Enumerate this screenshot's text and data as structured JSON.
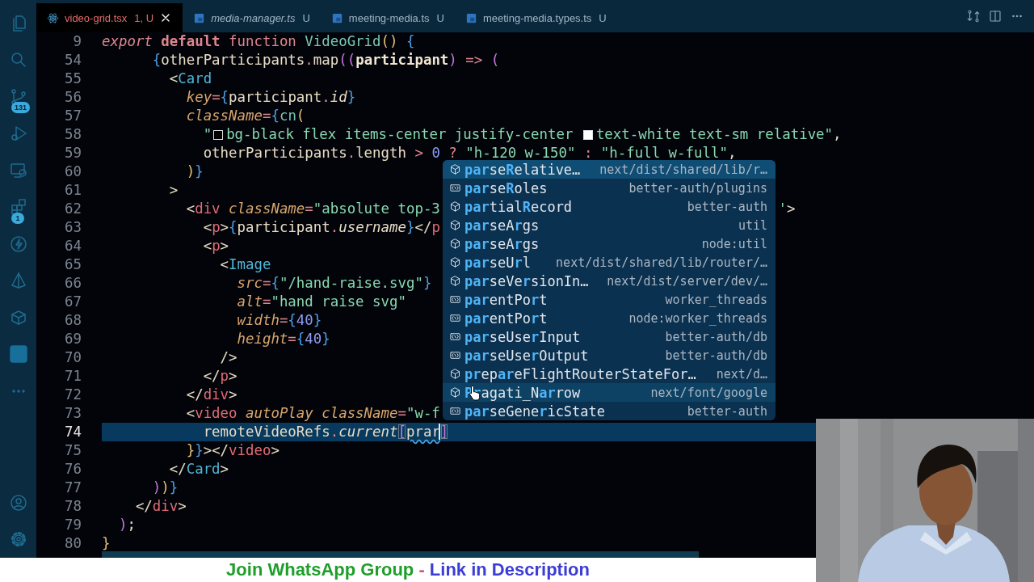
{
  "activity_bar": {
    "items": [
      {
        "kind": "files"
      },
      {
        "kind": "search"
      },
      {
        "kind": "source-control",
        "badge": "131"
      },
      {
        "kind": "debug"
      },
      {
        "kind": "remote"
      },
      {
        "kind": "extensions",
        "badge": "1"
      },
      {
        "kind": "bolt"
      },
      {
        "kind": "prism"
      },
      {
        "kind": "box"
      },
      {
        "kind": "square"
      },
      {
        "kind": "more"
      }
    ],
    "bottom_items": [
      {
        "kind": "account"
      },
      {
        "kind": "settings"
      }
    ]
  },
  "tabs": [
    {
      "kind": "tsx",
      "name": "video-grid.tsx",
      "status": "1, U",
      "selected": true,
      "preview": false,
      "has_errors": true
    },
    {
      "kind": "ts",
      "name": "media-manager.ts",
      "status": "U",
      "selected": false,
      "preview": true,
      "has_errors": false
    },
    {
      "kind": "ts",
      "name": "meeting-media.ts",
      "status": "U",
      "selected": false,
      "preview": false,
      "has_errors": false
    },
    {
      "kind": "ts",
      "name": "meeting-media.types.ts",
      "status": "U",
      "selected": false,
      "preview": false,
      "has_errors": false
    }
  ],
  "editor": {
    "lines": [
      {
        "number": "9",
        "current": false,
        "tokens": [
          {
            "kind": "modifier",
            "t": "export "
          },
          {
            "kind": "storage",
            "t": "default "
          },
          {
            "kind": "keyword",
            "t": "function "
          },
          {
            "kind": "function",
            "t": "VideoGrid"
          },
          {
            "kind": "paren",
            "t": "() "
          },
          {
            "kind": "brace",
            "t": "{"
          }
        ]
      },
      {
        "number": "54",
        "current": false,
        "tokens": [
          {
            "kind": "brace",
            "t": "      {"
          },
          {
            "kind": "plain",
            "t": "otherParticipants"
          },
          {
            "kind": "operator",
            "t": "."
          },
          {
            "kind": "plain",
            "t": "map"
          },
          {
            "kind": "bracket",
            "t": "(("
          },
          {
            "kind": "parameter",
            "t": "participant"
          },
          {
            "kind": "bracket",
            "t": ") "
          },
          {
            "kind": "operator",
            "t": "=> "
          },
          {
            "kind": "bracket",
            "t": "("
          }
        ]
      },
      {
        "number": "55",
        "current": false,
        "tokens": [
          {
            "kind": "punctuation",
            "t": "        <"
          },
          {
            "kind": "component",
            "t": "Card"
          }
        ]
      },
      {
        "number": "56",
        "current": false,
        "tokens": [
          {
            "kind": "attribute",
            "t": "          key"
          },
          {
            "kind": "operator",
            "t": "="
          },
          {
            "kind": "brace",
            "t": "{"
          },
          {
            "kind": "plain",
            "t": "participant"
          },
          {
            "kind": "operator",
            "t": "."
          },
          {
            "kind": "property",
            "t": "id"
          },
          {
            "kind": "brace",
            "t": "}"
          }
        ]
      },
      {
        "number": "57",
        "current": false,
        "tokens": [
          {
            "kind": "attribute",
            "t": "          className"
          },
          {
            "kind": "operator",
            "t": "="
          },
          {
            "kind": "brace",
            "t": "{"
          },
          {
            "kind": "function",
            "t": "cn"
          },
          {
            "kind": "paren",
            "t": "("
          }
        ]
      },
      {
        "number": "58",
        "current": false,
        "tokens": [
          {
            "kind": "string",
            "t": "            \""
          },
          {
            "kind": "swatch",
            "color": "#000000"
          },
          {
            "kind": "string",
            "t": "bg-black flex items-center justify-center "
          },
          {
            "kind": "swatch",
            "color": "#ffffff"
          },
          {
            "kind": "string",
            "t": "text-white text-sm relative\""
          },
          {
            "kind": "punctuation",
            "t": ","
          }
        ]
      },
      {
        "number": "59",
        "current": false,
        "tokens": [
          {
            "kind": "plain",
            "t": "            otherParticipants"
          },
          {
            "kind": "operator",
            "t": "."
          },
          {
            "kind": "plain",
            "t": "length "
          },
          {
            "kind": "operator",
            "t": "> "
          },
          {
            "kind": "number",
            "t": "0 "
          },
          {
            "kind": "operator",
            "t": "? "
          },
          {
            "kind": "string",
            "t": "\"h-120 w-150\" "
          },
          {
            "kind": "operator",
            "t": ": "
          },
          {
            "kind": "string",
            "t": "\"h-full w-full\""
          },
          {
            "kind": "punctuation",
            "t": ","
          }
        ]
      },
      {
        "number": "60",
        "current": false,
        "tokens": [
          {
            "kind": "paren",
            "t": "          )"
          },
          {
            "kind": "brace",
            "t": "}"
          }
        ]
      },
      {
        "number": "61",
        "current": false,
        "tokens": [
          {
            "kind": "punctuation",
            "t": "        >"
          }
        ]
      },
      {
        "number": "62",
        "current": false,
        "tokens": [
          {
            "kind": "punctuation",
            "t": "          <"
          },
          {
            "kind": "tag",
            "t": "div "
          },
          {
            "kind": "attribute",
            "t": "className"
          },
          {
            "kind": "operator",
            "t": "="
          },
          {
            "kind": "string",
            "t": "\"absolute top-3"
          }
        ],
        "tail": [
          {
            "kind": "string",
            "t": "'"
          },
          {
            "kind": "punctuation",
            "t": ">"
          }
        ]
      },
      {
        "number": "63",
        "current": false,
        "tokens": [
          {
            "kind": "punctuation",
            "t": "            <"
          },
          {
            "kind": "tag",
            "t": "p"
          },
          {
            "kind": "punctuation",
            "t": ">"
          },
          {
            "kind": "brace",
            "t": "{"
          },
          {
            "kind": "plain",
            "t": "participant"
          },
          {
            "kind": "operator",
            "t": "."
          },
          {
            "kind": "property",
            "t": "username"
          },
          {
            "kind": "brace",
            "t": "}"
          },
          {
            "kind": "punctuation",
            "t": "</"
          },
          {
            "kind": "tag",
            "t": "p"
          }
        ]
      },
      {
        "number": "64",
        "current": false,
        "tokens": [
          {
            "kind": "punctuation",
            "t": "            <"
          },
          {
            "kind": "tag",
            "t": "p"
          },
          {
            "kind": "punctuation",
            "t": ">"
          }
        ]
      },
      {
        "number": "65",
        "current": false,
        "tokens": [
          {
            "kind": "punctuation",
            "t": "              <"
          },
          {
            "kind": "component",
            "t": "Image"
          }
        ]
      },
      {
        "number": "66",
        "current": false,
        "tokens": [
          {
            "kind": "attribute",
            "t": "                src"
          },
          {
            "kind": "operator",
            "t": "="
          },
          {
            "kind": "brace",
            "t": "{"
          },
          {
            "kind": "string",
            "t": "\"/hand-raise.svg\""
          },
          {
            "kind": "brace",
            "t": "}"
          }
        ]
      },
      {
        "number": "67",
        "current": false,
        "tokens": [
          {
            "kind": "attribute",
            "t": "                alt"
          },
          {
            "kind": "operator",
            "t": "="
          },
          {
            "kind": "string",
            "t": "\"hand raise svg\""
          }
        ]
      },
      {
        "number": "68",
        "current": false,
        "tokens": [
          {
            "kind": "attribute",
            "t": "                width"
          },
          {
            "kind": "operator",
            "t": "="
          },
          {
            "kind": "brace",
            "t": "{"
          },
          {
            "kind": "number",
            "t": "40"
          },
          {
            "kind": "brace",
            "t": "}"
          }
        ]
      },
      {
        "number": "69",
        "current": false,
        "tokens": [
          {
            "kind": "attribute",
            "t": "                height"
          },
          {
            "kind": "operator",
            "t": "="
          },
          {
            "kind": "brace",
            "t": "{"
          },
          {
            "kind": "number",
            "t": "40"
          },
          {
            "kind": "brace",
            "t": "}"
          }
        ]
      },
      {
        "number": "70",
        "current": false,
        "tokens": [
          {
            "kind": "punctuation",
            "t": "              />"
          }
        ]
      },
      {
        "number": "71",
        "current": false,
        "tokens": [
          {
            "kind": "punctuation",
            "t": "            </"
          },
          {
            "kind": "tag",
            "t": "p"
          },
          {
            "kind": "punctuation",
            "t": ">"
          }
        ]
      },
      {
        "number": "72",
        "current": false,
        "tokens": [
          {
            "kind": "punctuation",
            "t": "          </"
          },
          {
            "kind": "tag",
            "t": "div"
          },
          {
            "kind": "punctuation",
            "t": ">"
          }
        ]
      },
      {
        "number": "73",
        "current": false,
        "tokens": [
          {
            "kind": "punctuation",
            "t": "          <"
          },
          {
            "kind": "tag",
            "t": "video "
          },
          {
            "kind": "attribute",
            "t": "autoPlay className"
          },
          {
            "kind": "operator",
            "t": "="
          },
          {
            "kind": "string",
            "t": "\"w-f"
          }
        ]
      },
      {
        "number": "74",
        "current": true,
        "tokens": [
          {
            "kind": "plain",
            "t": "            remoteVideoRefs"
          },
          {
            "kind": "operator",
            "t": "."
          },
          {
            "kind": "property",
            "t": "current"
          },
          {
            "kind": "match",
            "t": "["
          },
          {
            "kind": "typed",
            "t": "prar"
          },
          {
            "kind": "match",
            "t": "]"
          }
        ]
      },
      {
        "number": "75",
        "current": false,
        "tokens": [
          {
            "kind": "paren",
            "t": "          }"
          },
          {
            "kind": "brace",
            "t": "}"
          },
          {
            "kind": "punctuation",
            "t": "></"
          },
          {
            "kind": "tag",
            "t": "video"
          },
          {
            "kind": "punctuation",
            "t": ">"
          }
        ]
      },
      {
        "number": "76",
        "current": false,
        "tokens": [
          {
            "kind": "punctuation",
            "t": "        </"
          },
          {
            "kind": "component",
            "t": "Card"
          },
          {
            "kind": "punctuation",
            "t": ">"
          }
        ]
      },
      {
        "number": "77",
        "current": false,
        "tokens": [
          {
            "kind": "bracket",
            "t": "      )"
          },
          {
            "kind": "paren",
            "t": ")"
          },
          {
            "kind": "brace",
            "t": "}"
          }
        ]
      },
      {
        "number": "78",
        "current": false,
        "tokens": [
          {
            "kind": "punctuation",
            "t": "    </"
          },
          {
            "kind": "tag",
            "t": "div"
          },
          {
            "kind": "punctuation",
            "t": ">"
          }
        ]
      },
      {
        "number": "79",
        "current": false,
        "tokens": [
          {
            "kind": "bracket",
            "t": "  )"
          },
          {
            "kind": "punctuation",
            "t": ";"
          }
        ]
      },
      {
        "number": "80",
        "current": false,
        "tokens": [
          {
            "kind": "paren",
            "t": "}"
          }
        ]
      }
    ]
  },
  "suggestions": [
    {
      "kind": "class",
      "label": "**par**se**R**elative…",
      "detail": "next/dist/shared/lib/r…",
      "selected": true,
      "hovered": false
    },
    {
      "kind": "variable",
      "label": "**par**se**R**oles",
      "detail": "better-auth/plugins",
      "selected": false,
      "hovered": false
    },
    {
      "kind": "class",
      "label": "**par**tial**R**ecord",
      "detail": "better-auth",
      "selected": false,
      "hovered": false
    },
    {
      "kind": "class",
      "label": "**par**seA**r**gs",
      "detail": "util",
      "selected": false,
      "hovered": false
    },
    {
      "kind": "class",
      "label": "**par**seA**r**gs",
      "detail": "node:util",
      "selected": false,
      "hovered": false
    },
    {
      "kind": "class",
      "label": "**par**seU**r**l",
      "detail": "next/dist/shared/lib/router/…",
      "selected": false,
      "hovered": false
    },
    {
      "kind": "class",
      "label": "**par**seVe**r**sionIn…",
      "detail": "next/dist/server/dev/…",
      "selected": false,
      "hovered": false
    },
    {
      "kind": "variable",
      "label": "**par**entPo**r**t",
      "detail": "worker_threads",
      "selected": false,
      "hovered": false
    },
    {
      "kind": "variable",
      "label": "**par**entPo**r**t",
      "detail": "node:worker_threads",
      "selected": false,
      "hovered": false
    },
    {
      "kind": "variable",
      "label": "**par**seUse**r**Input",
      "detail": "better-auth/db",
      "selected": false,
      "hovered": false
    },
    {
      "kind": "variable",
      "label": "**par**seUse**r**Output",
      "detail": "better-auth/db",
      "selected": false,
      "hovered": false
    },
    {
      "kind": "class",
      "label": "**pr**ep**ar**eFlightRouterStateFor…",
      "detail": "next/d…",
      "selected": false,
      "hovered": false
    },
    {
      "kind": "class",
      "label": "**Pr**agati_N**ar**row",
      "detail": "next/font/google",
      "selected": false,
      "hovered": true
    },
    {
      "kind": "variable",
      "label": "**par**seGene**r**icState",
      "detail": "better-auth",
      "selected": false,
      "hovered": false
    }
  ],
  "banner": [
    {
      "text": "Join WhatsApp Group",
      "color": "#1f9e2a"
    },
    {
      "text": " - ",
      "color": "#d05a7a"
    },
    {
      "text": "Link in Description",
      "color": "#3c3cd6"
    }
  ]
}
